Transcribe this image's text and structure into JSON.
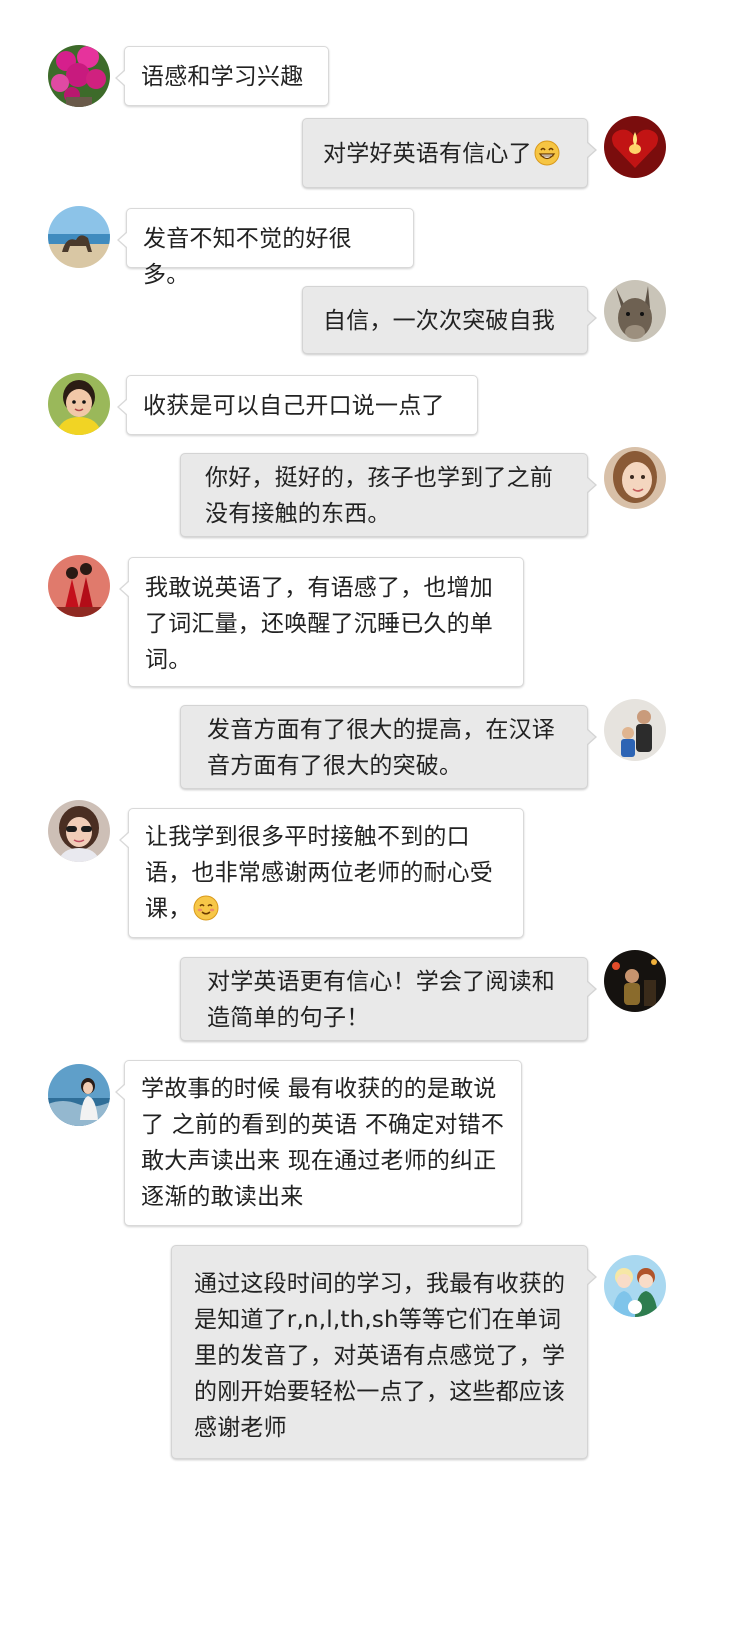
{
  "messages": [
    {
      "side": "in",
      "text": "语感和学习兴趣",
      "avatar": "magenta-flowers-avatar"
    },
    {
      "side": "out",
      "text": "对学好英语有信心了",
      "emoji": "grinning-face-emoji",
      "avatar": "candle-heart-avatar"
    },
    {
      "side": "in",
      "text": "发音不知不觉的好很多。",
      "avatar": "beach-camel-avatar"
    },
    {
      "side": "out",
      "text": "自信，一次次突破自我",
      "avatar": "donkey-avatar"
    },
    {
      "side": "in",
      "text": "收获是可以自己开口说一点了",
      "avatar": "child-yellow-shirt-avatar"
    },
    {
      "side": "out",
      "text": "你好，挺好的，孩子也学到了之前没有接触的东西。",
      "avatar": "girl-portrait-avatar"
    },
    {
      "side": "in",
      "text": "我敢说英语了，有语感了，也增加了词汇量，还唤醒了沉睡已久的单词。",
      "avatar": "red-dress-girls-avatar"
    },
    {
      "side": "out",
      "text": "发音方面有了很大的提高，在汉译音方面有了很大的突破。",
      "avatar": "parent-child-avatar"
    },
    {
      "side": "in",
      "text": "让我学到很多平时接触不到的口语，也非常感谢两位老师的耐心受课，",
      "emoji": "smiling-face-emoji",
      "avatar": "woman-sunglasses-avatar"
    },
    {
      "side": "out",
      "text": "对学英语更有信心！学会了阅读和造简单的句子！",
      "avatar": "dark-night-avatar"
    },
    {
      "side": "in",
      "text": "学故事的时候 最有收获的的是敢说了 之前的看到的英语 不确定对错不敢大声读出来 现在通过老师的纠正 逐渐的敢读出来",
      "avatar": "woman-sea-avatar"
    },
    {
      "side": "out",
      "text": "通过这段时间的学习，我最有收获的是知道了r,n,l,th,sh等等它们在单词里的发音了，对英语有点感觉了，学的刚开始要轻松一点了，这些都应该感谢老师",
      "avatar": "cartoon-princesses-avatar"
    }
  ]
}
